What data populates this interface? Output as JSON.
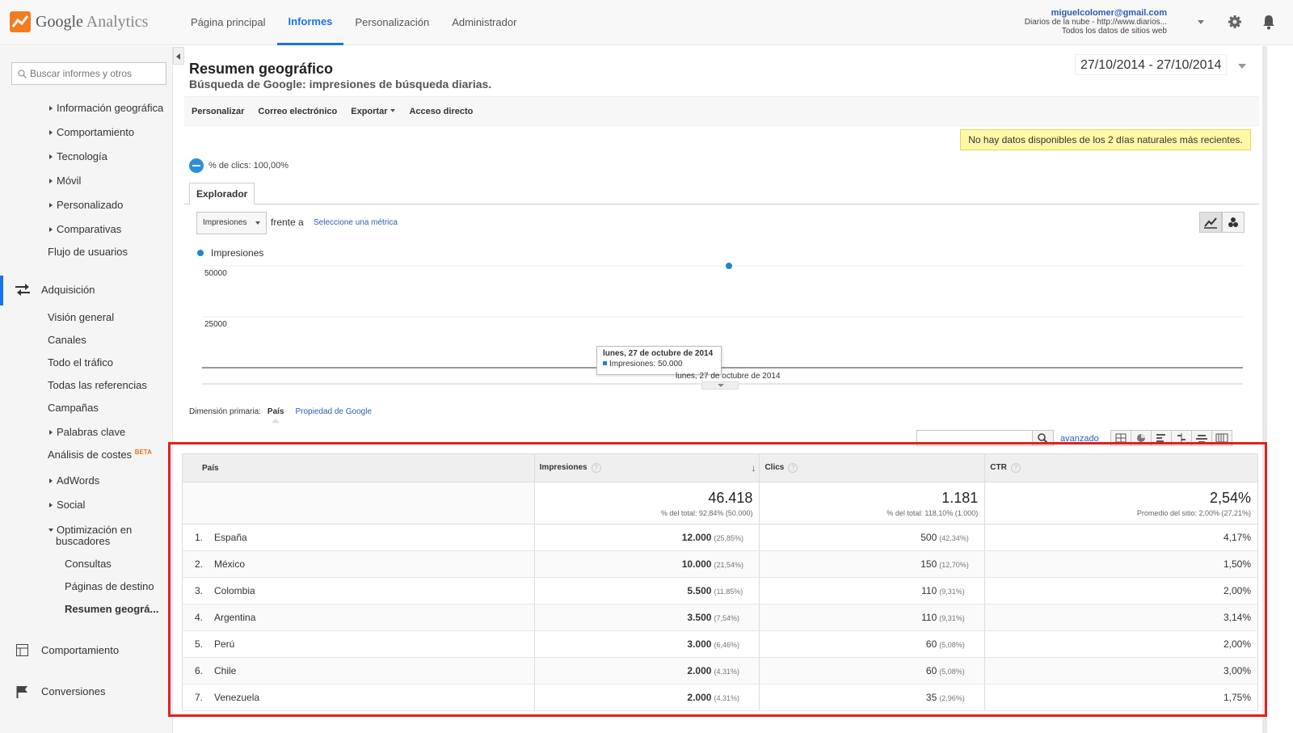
{
  "app": {
    "logo_text_1": "Google",
    "logo_text_2": "Analytics"
  },
  "nav": [
    {
      "label": "Página principal"
    },
    {
      "label": "Informes"
    },
    {
      "label": "Personalización"
    },
    {
      "label": "Administrador"
    }
  ],
  "account": {
    "email": "miguelcolomer@gmail.com",
    "property": "Diarios de la nube - http://www.diarios...",
    "view": "Todos los datos de sitios web"
  },
  "sidebar": {
    "search_placeholder": "Buscar informes y otros",
    "items": [
      "Información geográfica",
      "Comportamiento",
      "Tecnología",
      "Móvil",
      "Personalizado",
      "Comparativas",
      "Flujo de usuarios",
      "Adquisición",
      "Visión general",
      "Canales",
      "Todo el tráfico",
      "Todas las referencias",
      "Campañas",
      "Palabras clave",
      "Análisis de costes",
      "AdWords",
      "Social",
      "Optimización en",
      "buscadores",
      "Consultas",
      "Páginas de destino",
      "Resumen geográ...",
      "Comportamiento",
      "Conversiones"
    ],
    "beta": "BETA"
  },
  "report": {
    "title": "Resumen geográfico",
    "subtitle": "Búsqueda de Google: impresiones de búsqueda diarias.",
    "date_range": "27/10/2014 - 27/10/2014"
  },
  "toolbar": {
    "customize": "Personalizar",
    "email": "Correo electrónico",
    "export": "Exportar",
    "shortcut": "Acceso directo"
  },
  "notice": "No hay datos disponibles de los 2 días naturales más recientes.",
  "segment": "% de clics: 100,00%",
  "explorer": {
    "tab": "Explorador",
    "metric": "Impresiones",
    "versus": "frente a",
    "select_metric": "Seleccione una métrica",
    "legend": "Impresiones"
  },
  "chart_data": {
    "type": "line",
    "series": [
      {
        "name": "Impresiones",
        "values": [
          50000
        ]
      }
    ],
    "x": [
      "lunes, 27 de octubre de 2014"
    ],
    "y_ticks": [
      "50000",
      "25000"
    ],
    "ylim": [
      0,
      50000
    ],
    "tooltip_date": "lunes, 27 de octubre de 2014",
    "tooltip_value": "Impresiones: 50.000",
    "x_label": "lunes, 27 de octubre de 2014"
  },
  "dimension": {
    "label": "Dimensión primaria:",
    "current": "País",
    "other": "Propiedad de Google"
  },
  "table_controls": {
    "advanced": "avanzado"
  },
  "table": {
    "headers": [
      "País",
      "Impresiones",
      "Clics",
      "CTR"
    ],
    "totals": {
      "impressions": "46.418",
      "impressions_sub": "% del total: 92,84% (50.000)",
      "clicks": "1.181",
      "clicks_sub": "% del total: 118,10% (1.000)",
      "ctr": "2,54%",
      "ctr_sub": "Promedio del sitio: 2,00% (27,21%)"
    },
    "rows": [
      {
        "n": "1.",
        "country": "España",
        "imp": "12.000",
        "imp_pct": "(25,85%)",
        "clicks": "500",
        "clicks_pct": "(42,34%)",
        "ctr": "4,17%"
      },
      {
        "n": "2.",
        "country": "México",
        "imp": "10.000",
        "imp_pct": "(21,54%)",
        "clicks": "150",
        "clicks_pct": "(12,70%)",
        "ctr": "1,50%"
      },
      {
        "n": "3.",
        "country": "Colombia",
        "imp": "5.500",
        "imp_pct": "(11,85%)",
        "clicks": "110",
        "clicks_pct": "(9,31%)",
        "ctr": "2,00%"
      },
      {
        "n": "4.",
        "country": "Argentina",
        "imp": "3.500",
        "imp_pct": "(7,54%)",
        "clicks": "110",
        "clicks_pct": "(9,31%)",
        "ctr": "3,14%"
      },
      {
        "n": "5.",
        "country": "Perú",
        "imp": "3.000",
        "imp_pct": "(6,46%)",
        "clicks": "60",
        "clicks_pct": "(5,08%)",
        "ctr": "2,00%"
      },
      {
        "n": "6.",
        "country": "Chile",
        "imp": "2.000",
        "imp_pct": "(4,31%)",
        "clicks": "60",
        "clicks_pct": "(5,08%)",
        "ctr": "3,00%"
      },
      {
        "n": "7.",
        "country": "Venezuela",
        "imp": "2.000",
        "imp_pct": "(4,31%)",
        "clicks": "35",
        "clicks_pct": "(2,96%)",
        "ctr": "1,75%"
      }
    ]
  },
  "colors": {
    "accent": "#1a73e8",
    "series": "#1e88c7",
    "highlight_box": "#e02020",
    "notice_bg": "#fff8a8"
  }
}
